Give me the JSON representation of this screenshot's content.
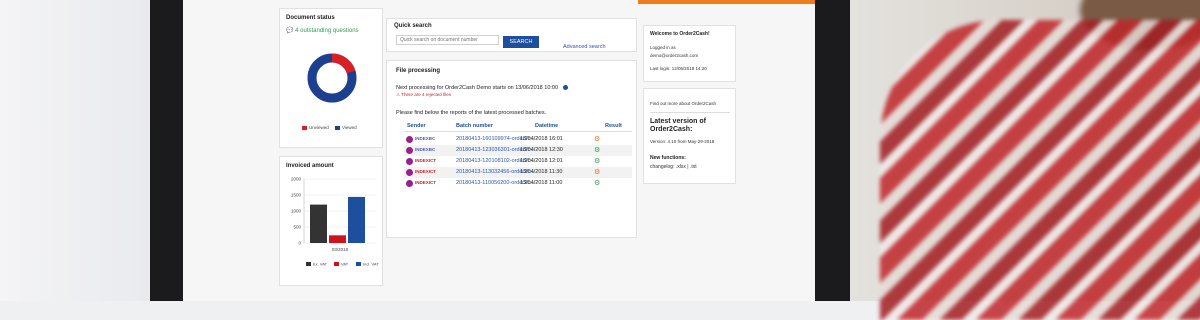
{
  "document_status": {
    "title": "Document status",
    "outstanding_link": "4 outstanding questions",
    "chart": {
      "unviewed": 0.2,
      "viewed": 0.8
    },
    "legend": [
      "Unviewed",
      "Viewed"
    ]
  },
  "invoiced": {
    "title": "Invoiced amount",
    "chart_data": {
      "type": "bar",
      "categories": [
        "03/2018"
      ],
      "series": [
        {
          "name": "Ex. VAT",
          "values": [
            1200
          ]
        },
        {
          "name": "VAT",
          "values": [
            240
          ]
        },
        {
          "name": "Incl. VAT",
          "values": [
            1440
          ]
        }
      ],
      "yticks": [
        "2000",
        "1500",
        "1000",
        "500",
        "0"
      ],
      "ylim": [
        0,
        2000
      ]
    },
    "legend": [
      "Ex. VAT",
      "VAT",
      "Incl. VAT"
    ],
    "colors": [
      "#333333",
      "#d0121b",
      "#1d4f9c"
    ]
  },
  "quick_search": {
    "title": "Quick search",
    "placeholder": "Quick search on document number",
    "button": "SEARCH",
    "advanced": "Advanced search"
  },
  "file_processing": {
    "title": "File processing",
    "next": "Next processing for Order2Cash Demo starts on 13/06/2018 10:00",
    "warning": "There are 4 rejected files",
    "find_below": "Please find below the reports of the latest processed batches.",
    "headers": [
      "Sender",
      "Batch number",
      "Datetime",
      "Result"
    ],
    "rows": [
      {
        "sender": "INDEXBC",
        "batch": "20180413-160109974-order2c...",
        "datetime": "13/04/2018  16:01",
        "result": "error"
      },
      {
        "sender": "INDEXBC",
        "batch": "20180413-123036301-order2c...",
        "datetime": "13/04/2018  12:30",
        "result": "ok"
      },
      {
        "sender": "INDEXICT",
        "batch": "20180413-120108102-order2c...",
        "datetime": "13/04/2018  12:01",
        "result": "ok"
      },
      {
        "sender": "INDEXICT",
        "batch": "20180413-113032456-order2c...",
        "datetime": "13/04/2018  11:30",
        "result": "error"
      },
      {
        "sender": "INDEXICT",
        "batch": "20180413-110056200-order2c...",
        "datetime": "13/04/2018  11:00",
        "result": "ok"
      }
    ]
  },
  "welcome": {
    "title": "Welcome to Order2Cash!",
    "logged_as": "Logged in as",
    "email": "demo@order2cash.com",
    "last_login": "Last login: 12/06/2018 14:20"
  },
  "latest": {
    "find_more": "Find out more about Order2Cash",
    "title": "Latest version of Order2Cash:",
    "version": "Version: 4.10 from May-29-2018",
    "new_functions": "New functions:",
    "changelog": "changelog: .xlsx | .txt"
  }
}
